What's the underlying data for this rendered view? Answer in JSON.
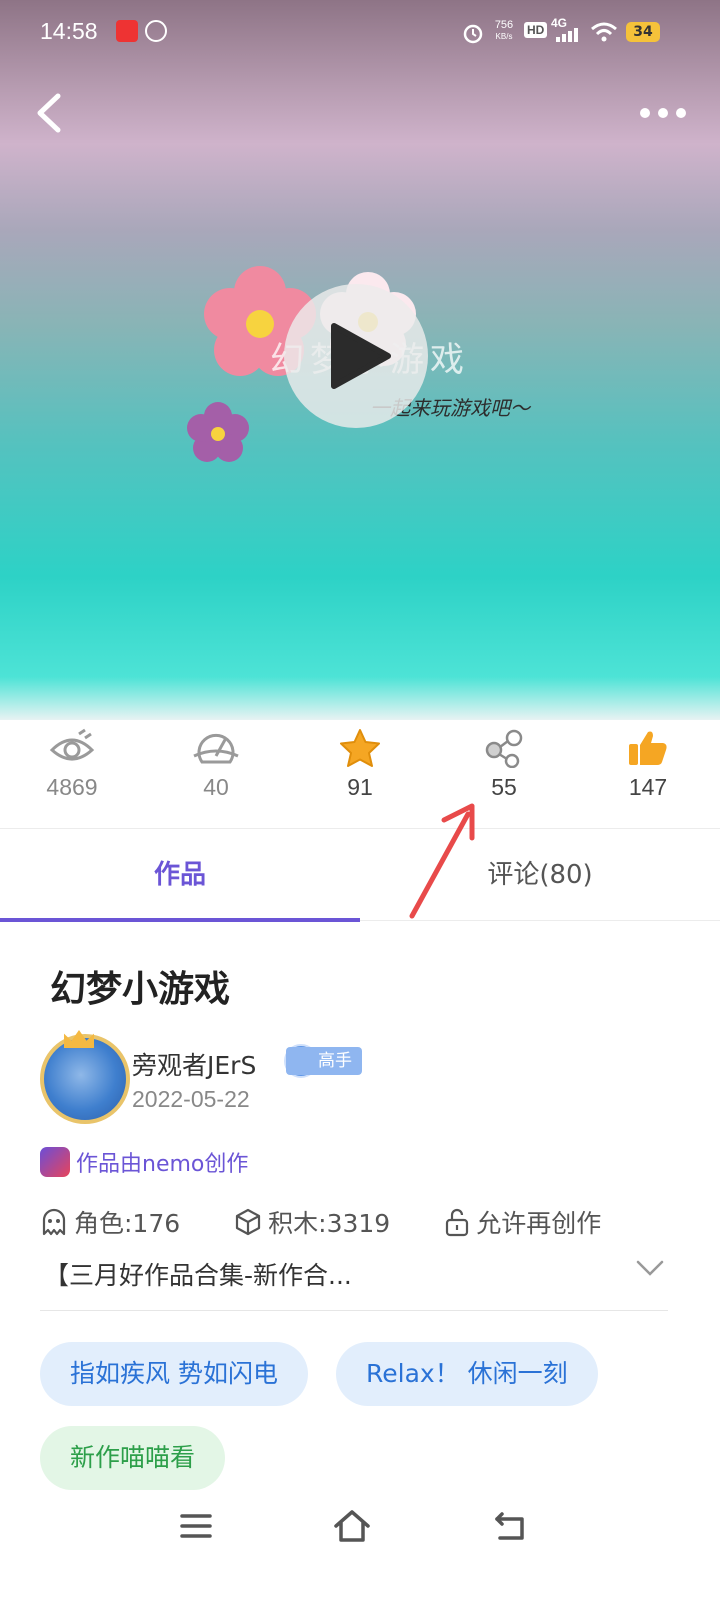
{
  "status_bar": {
    "time": "14:58",
    "net_speed_value": "756",
    "net_speed_unit": "KB/s",
    "hd_label": "HD",
    "signal_label": "4G",
    "battery": "34"
  },
  "hero": {
    "art_title": "幻梦小游戏",
    "art_subtitle": "一起来玩游戏吧～"
  },
  "stats": [
    {
      "icon": "eye-icon",
      "value": "4869"
    },
    {
      "icon": "gauge-icon",
      "value": "40"
    },
    {
      "icon": "star-icon",
      "value": "91"
    },
    {
      "icon": "share-icon",
      "value": "55"
    },
    {
      "icon": "thumbs-up-icon",
      "value": "147"
    }
  ],
  "tabs": {
    "works": "作品",
    "comments": "评论(80)"
  },
  "work": {
    "title": "幻梦小游戏",
    "author": "旁观者JErS",
    "badge": "高手",
    "date": "2022-05-22",
    "made_by": "作品由nemo创作",
    "roles": "角色:176",
    "blocks": "积木:3319",
    "remix": "允许再创作",
    "description": "【三月好作品合集-新作合..."
  },
  "tags": [
    "指如疾风 势如闪电",
    "Relax！ 休闲一刻",
    "新作喵喵看"
  ],
  "colors": {
    "accent": "#6b55d6",
    "star": "#f5a623",
    "arrow": "#e84a4a"
  }
}
